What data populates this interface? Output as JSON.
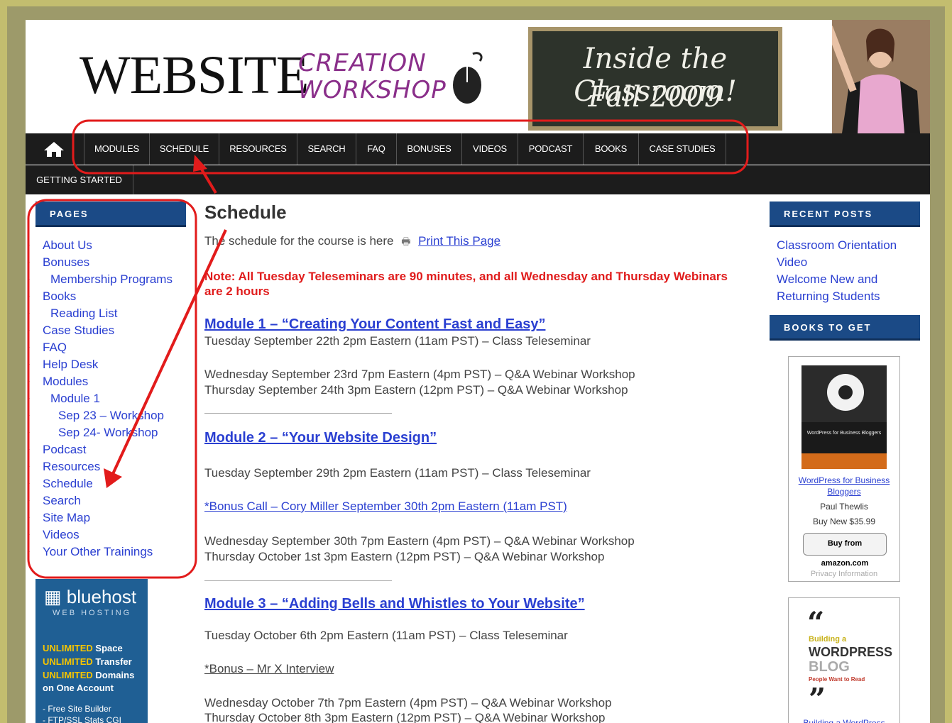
{
  "header": {
    "logo_website": "WEBSITE",
    "logo_creation": "CREATION",
    "logo_workshop": "WORKSHOP",
    "chalk_line1": "Inside the Classroom!",
    "chalk_line2": "Fall 2009"
  },
  "nav": {
    "items": [
      "MODULES",
      "SCHEDULE",
      "RESOURCES",
      "SEARCH",
      "FAQ",
      "BONUSES",
      "VIDEOS",
      "PODCAST",
      "BOOKS",
      "CASE STUDIES"
    ],
    "second_row": "GETTING STARTED"
  },
  "sidebar": {
    "title": "PAGES",
    "items": [
      "About Us",
      "Bonuses",
      "Membership Programs",
      "Books",
      "Reading List",
      "Case Studies",
      "FAQ",
      "Help Desk",
      "Modules",
      "Module 1",
      "Sep 23 – Workshop",
      "Sep 24- Workshop",
      "Podcast",
      "Resources",
      "Schedule",
      "Search",
      "Site Map",
      "Videos",
      "Your Other Trainings"
    ]
  },
  "bluehost": {
    "logo": "bluehost",
    "sub": "WEB HOSTING",
    "unlimited": "UNLIMITED",
    "line1": "Space",
    "line2": "Transfer",
    "line3": "Domains",
    "line4": "on One Account",
    "line5": "- Free Site Builder",
    "line6": "- FTP/SSL Stats CGI"
  },
  "main": {
    "title": "Schedule",
    "intro": "The schedule for the course is here",
    "print_link": "Print This Page",
    "note": "Note: All Tuesday Teleseminars are 90 minutes, and all Wednesday and Thursday Webinars are 2 hours",
    "module1": {
      "title": "Module 1 – “Creating Your Content Fast and Easy”",
      "line1": "Tuesday September 22th 2pm Eastern (11am PST) – Class Teleseminar",
      "line2": "Wednesday September 23rd 7pm Eastern (4pm PST) – Q&A Webinar Workshop",
      "line3": "Thursday September 24th 3pm Eastern (12pm PST) – Q&A Webinar Workshop"
    },
    "module2": {
      "title": "Module 2 – “Your Website Design”",
      "line1": "Tuesday September 29th 2pm Eastern (11am PST) – Class Teleseminar",
      "bonus": "*Bonus Call – Cory Miller    September 30th 2pm Eastern (11am PST)",
      "line2": "Wednesday September 30th 7pm Eastern (4pm PST) – Q&A Webinar Workshop",
      "line3": "Thursday October 1st 3pm Eastern (12pm PST) – Q&A Webinar Workshop"
    },
    "module3": {
      "title": "Module 3 – “Adding Bells and Whistles to Your Website”",
      "line1": "Tuesday October 6th 2pm Eastern (11am PST) – Class Teleseminar",
      "bonus": "*Bonus – Mr X Interview",
      "line2": "Wednesday October 7th 7pm Eastern (4pm PST) – Q&A Webinar Workshop",
      "line3": "Thursday October 8th 3pm Eastern (12pm PST) – Q&A Webinar Workshop"
    }
  },
  "right": {
    "recent_title": "RECENT POSTS",
    "recent_posts": [
      "Classroom Orientation Video",
      "Welcome New and Returning Students"
    ],
    "books_title": "BOOKS TO GET",
    "book1": {
      "link": "WordPress for Business Bloggers",
      "author": "Paul Thewlis",
      "price": "Buy New $35.99",
      "cover_text": "WordPress for Business Bloggers",
      "amazon_buy": "Buy from",
      "amazon": "amazon.com",
      "privacy": "Privacy Information"
    },
    "book2": {
      "line1": "Building a",
      "line2": "WORDPRESS",
      "line3": "BLOG",
      "line4": "People Want to Read",
      "link": "Building a WordPress"
    }
  },
  "colors": {
    "accent_blue": "#1b4a86",
    "link": "#2a3fd1",
    "note_red": "#e01c1c",
    "annotation_red": "#e21b1b"
  }
}
